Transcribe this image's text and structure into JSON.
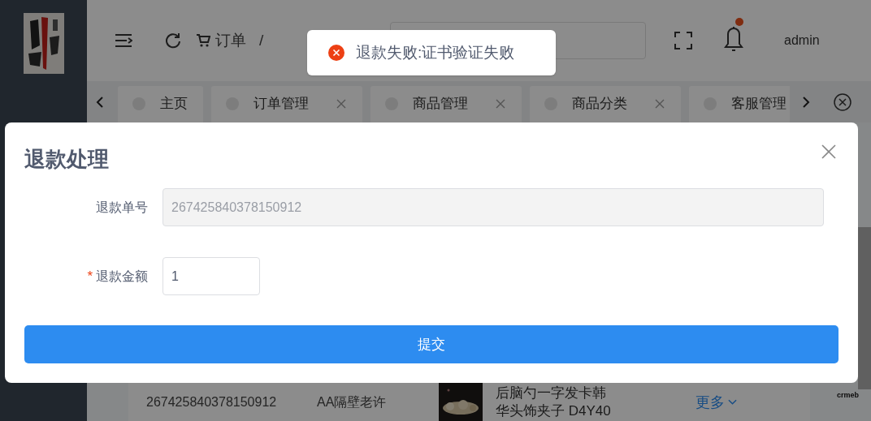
{
  "header": {
    "breadcrumb": [
      "订单",
      "/"
    ],
    "user": "admin",
    "has_notification": true
  },
  "tabs": [
    {
      "label": "主页",
      "closable": false,
      "selected": false
    },
    {
      "label": "订单管理",
      "closable": true,
      "selected": false
    },
    {
      "label": "商品管理",
      "closable": true,
      "selected": false
    },
    {
      "label": "商品分类",
      "closable": true,
      "selected": false
    },
    {
      "label": "客服管理",
      "selected": false
    }
  ],
  "table_row": {
    "order_no": "267425840378150912",
    "user": "AA隔壁老许",
    "product_lines": [
      "后脑勺一字发卡韩",
      "华头饰夹子 D4Y40"
    ],
    "action": "更多"
  },
  "footer_logo": "crmeb",
  "toast": {
    "message": "退款失败:证书验证失败"
  },
  "dialog": {
    "title": "退款处理",
    "fields": [
      {
        "label": "退款单号",
        "value": "267425840378150912",
        "disabled": true
      },
      {
        "label": "退款金额",
        "value": "1",
        "disabled": false,
        "required_mark": "*"
      }
    ],
    "submit": "提交"
  }
}
